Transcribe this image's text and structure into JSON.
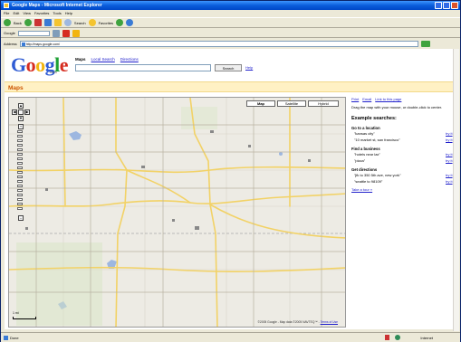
{
  "window": {
    "title": "Google Maps - Microsoft Internet Explorer"
  },
  "menu": {
    "items": [
      "File",
      "Edit",
      "View",
      "Favorites",
      "Tools",
      "Help"
    ]
  },
  "toolbar": {
    "back_label": "Back",
    "search_label": "Search",
    "favorites_label": "Favorites"
  },
  "googlebar": {
    "label": "Google"
  },
  "addressbar": {
    "label": "Address",
    "url": "http://maps.google.com/"
  },
  "page": {
    "logo_text": "Google",
    "logo_sub": "beta",
    "tabs": [
      "Maps",
      "Local Search",
      "Directions"
    ],
    "search_button": "Search",
    "help_link": "Help",
    "section_title": "Maps"
  },
  "map": {
    "types": [
      "Map",
      "Satellite",
      "Hybrid"
    ],
    "selected_type": "Map",
    "scale_label": "1 mi",
    "copyright": "©2005 Google - Map data ©2005 NAVTEQ™ -",
    "terms": "Terms of Use"
  },
  "sidebar": {
    "links": [
      "Print",
      "Email",
      "Link to this page"
    ],
    "description": "Drag the map with your mouse, or double-click to center.",
    "heading": "Example searches:",
    "sections": [
      {
        "title": "Go to a location",
        "examples": [
          {
            "query": "\"kansas city\"",
            "action": "try it"
          },
          {
            "query": "\"10 market st, san francisco\"",
            "action": "try it"
          }
        ]
      },
      {
        "title": "Find a business",
        "examples": [
          {
            "query": "\"hotels near lax\"",
            "action": "try it"
          },
          {
            "query": "\"pizza\"",
            "action": "try it"
          }
        ]
      },
      {
        "title": "Get directions",
        "examples": [
          {
            "query": "\"jfk to 350 5th ave, new york\"",
            "action": "try it"
          },
          {
            "query": "\"seattle to 98109\"",
            "action": "try it"
          }
        ]
      }
    ],
    "more_link": "Take a tour »"
  },
  "status": {
    "left": "Done",
    "zone": "Internet"
  }
}
